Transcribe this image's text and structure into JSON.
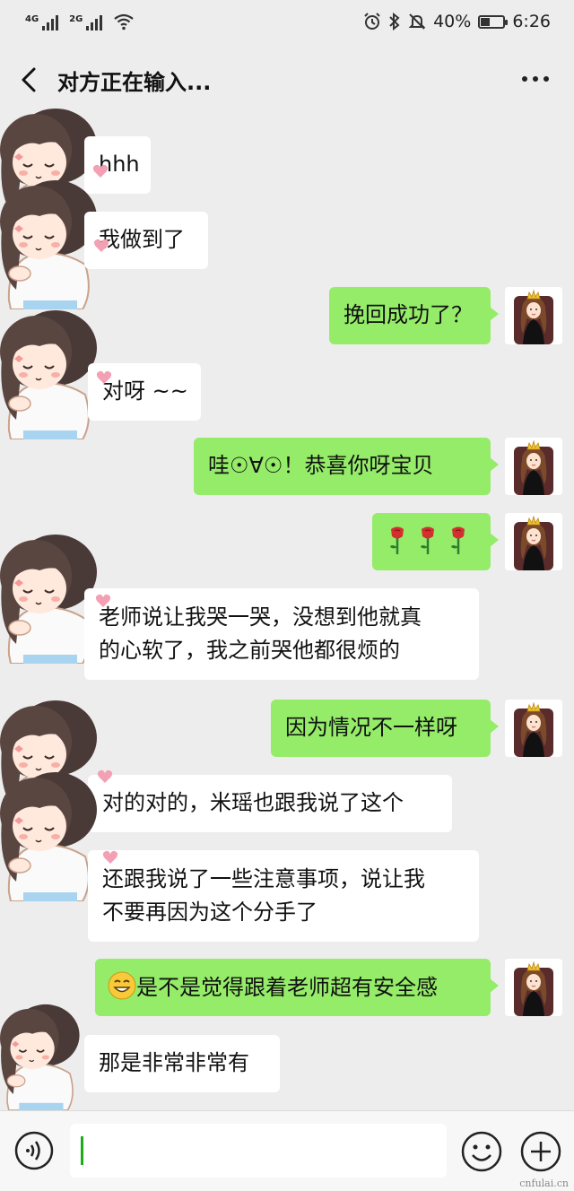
{
  "status_bar": {
    "network_1": "4G",
    "network_2": "2G",
    "battery_text": "40%",
    "battery_level": 0.4,
    "time": "6:26",
    "icons": [
      "signal-icon",
      "signal-icon",
      "wifi-icon",
      "alarm-icon",
      "bluetooth-icon",
      "mute-icon",
      "battery-icon"
    ]
  },
  "header": {
    "title": "对方正在输入...",
    "back_icon": "chevron-left-icon",
    "more_icon": "more-dots-icon"
  },
  "messages": [
    {
      "side": "left",
      "text": "hhh"
    },
    {
      "side": "left",
      "text": "我做到了"
    },
    {
      "side": "right",
      "text": "挽回成功了？"
    },
    {
      "side": "left",
      "text": "对呀 ~~"
    },
    {
      "side": "right",
      "text": "哇☉∀☉！恭喜你呀宝贝"
    },
    {
      "side": "right",
      "text": "🌹🌹🌹",
      "emoji": "rose-icon"
    },
    {
      "side": "left",
      "lines": [
        "老师说让我哭一哭，没想到他就真",
        "的心软了，我之前哭他都很烦的"
      ]
    },
    {
      "side": "right",
      "text": "因为情况不一样呀"
    },
    {
      "side": "left",
      "text": "对的对的，米瑶也跟我说了这个"
    },
    {
      "side": "left",
      "lines": [
        "还跟我说了一些注意事项，说让我",
        "不要再因为这个分手了"
      ]
    },
    {
      "side": "right",
      "text": "是不是觉得跟着老师超有安全感",
      "emoji": "grin-emoji-icon"
    },
    {
      "side": "left",
      "text": "那是非常非常有"
    }
  ],
  "input_bar": {
    "voice_icon": "voice-icon",
    "emoji_icon": "emoji-icon",
    "plus_icon": "plus-icon",
    "value": ""
  },
  "watermark": "cnfulai.cn",
  "colors": {
    "background": "#ededed",
    "bubble_self": "#95ec69",
    "bubble_other": "#ffffff"
  }
}
